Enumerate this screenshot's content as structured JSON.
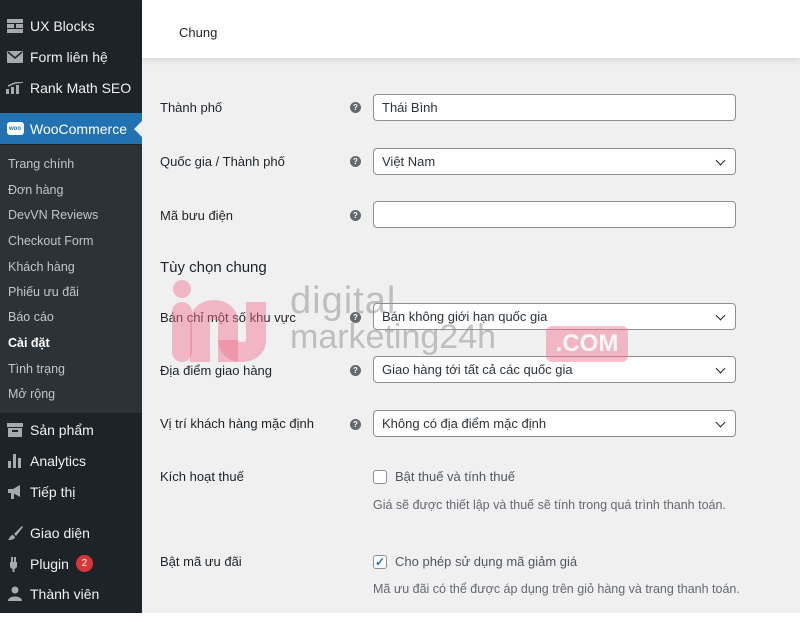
{
  "sidebar": {
    "top_items": [
      {
        "label": "UX Blocks",
        "icon": "blocks-icon"
      },
      {
        "label": "Form liên hệ",
        "icon": "envelope-icon"
      },
      {
        "label": "Rank Math SEO",
        "icon": "chart-icon"
      }
    ],
    "woocommerce": {
      "label": "WooCommerce",
      "icon": "woo-icon",
      "icon_text": "woo"
    },
    "submenu": [
      {
        "label": "Trang chính"
      },
      {
        "label": "Đơn hàng"
      },
      {
        "label": "DevVN Reviews"
      },
      {
        "label": "Checkout Form"
      },
      {
        "label": "Khách hàng"
      },
      {
        "label": "Phiếu ưu đãi"
      },
      {
        "label": "Báo cáo"
      },
      {
        "label": "Cài đặt",
        "current": true
      },
      {
        "label": "Tình trạng"
      },
      {
        "label": "Mở rộng"
      }
    ],
    "bottom_items": [
      {
        "label": "Sản phẩm",
        "icon": "archive-icon"
      },
      {
        "label": "Analytics",
        "icon": "bar-chart-icon"
      },
      {
        "label": "Tiếp thị",
        "icon": "megaphone-icon"
      },
      {
        "label": "Giao diện",
        "icon": "brush-icon"
      },
      {
        "label": "Plugin",
        "icon": "plugin-icon",
        "badge": "2"
      },
      {
        "label": "Thành viên",
        "icon": "user-icon"
      }
    ]
  },
  "header": {
    "tab": "Chung"
  },
  "form": {
    "city": {
      "label": "Thành phố",
      "value": "Thái Bình"
    },
    "country": {
      "label": "Quốc gia / Thành phố",
      "value": "Việt Nam"
    },
    "postcode": {
      "label": "Mã bưu điện",
      "value": ""
    },
    "section_title": "Tùy chọn chung",
    "selling": {
      "label": "Bán chỉ một số khu vực",
      "value": "Bán không giới hạn quốc gia"
    },
    "shipping": {
      "label": "Địa điểm giao hàng",
      "value": "Giao hàng tới tất cả các quốc gia"
    },
    "default_location": {
      "label": "Vị trí khách hàng mặc định",
      "value": "Không có địa điểm mặc định"
    },
    "tax": {
      "label": "Kích hoạt thuế",
      "checkbox_label": "Bật thuế và tính thuế",
      "checked": false,
      "description": "Giá sẽ được thiết lập và thuế sẽ tính trong quá trình thanh toán."
    },
    "coupons": {
      "label": "Bật mã ưu đãi",
      "checkbox_label": "Cho phép sử dụng mã giảm giá",
      "checked": true,
      "description": "Mã ưu đãi có thể được áp dụng trên giỏ hàng và trang thanh toán."
    },
    "help_glyph": "?",
    "check_glyph": "✓"
  },
  "watermark": {
    "line1": "digital",
    "line2": "marketing24h",
    "com": ".COM"
  },
  "colors": {
    "sidebar": "#1d2327",
    "submenu": "#2c3338",
    "accent": "#2271b1",
    "badge": "#d63638"
  }
}
